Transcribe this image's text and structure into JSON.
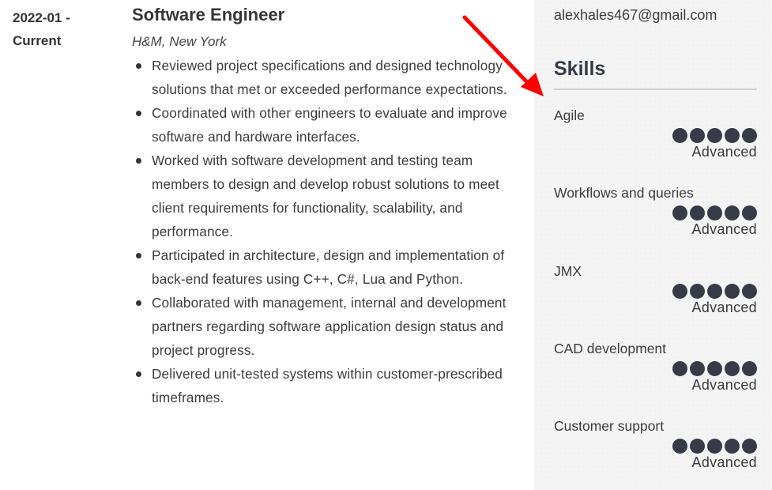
{
  "experience": {
    "date_start": "2022-01 -",
    "date_end": "Current",
    "title": "Software Engineer",
    "company": "H&M, New York",
    "bullets": [
      "Reviewed project specifications and designed technology solutions that met or exceeded performance expectations.",
      "Coordinated with other engineers to evaluate and improve software and hardware interfaces.",
      "Worked with software development and testing team members to design and develop robust solutions to meet client requirements for functionality, scalability, and performance.",
      "Participated in architecture, design and implementation of back-end features using C++, C#, Lua and Python.",
      "Collaborated with management, internal and development partners regarding software application design status and project progress.",
      "Delivered unit-tested systems within customer-prescribed timeframes."
    ]
  },
  "sidebar": {
    "email": "alexhales467@gmail.com",
    "skills_heading": "Skills",
    "skills": [
      {
        "name": "Agile",
        "rating": 5,
        "max": 5,
        "level": "Advanced"
      },
      {
        "name": "Workflows and queries",
        "rating": 5,
        "max": 5,
        "level": "Advanced"
      },
      {
        "name": "JMX",
        "rating": 5,
        "max": 5,
        "level": "Advanced"
      },
      {
        "name": "CAD development",
        "rating": 5,
        "max": 5,
        "level": "Advanced"
      },
      {
        "name": "Customer support",
        "rating": 5,
        "max": 5,
        "level": "Advanced"
      }
    ]
  },
  "annotation": {
    "arrow_color": "#ff0000"
  }
}
